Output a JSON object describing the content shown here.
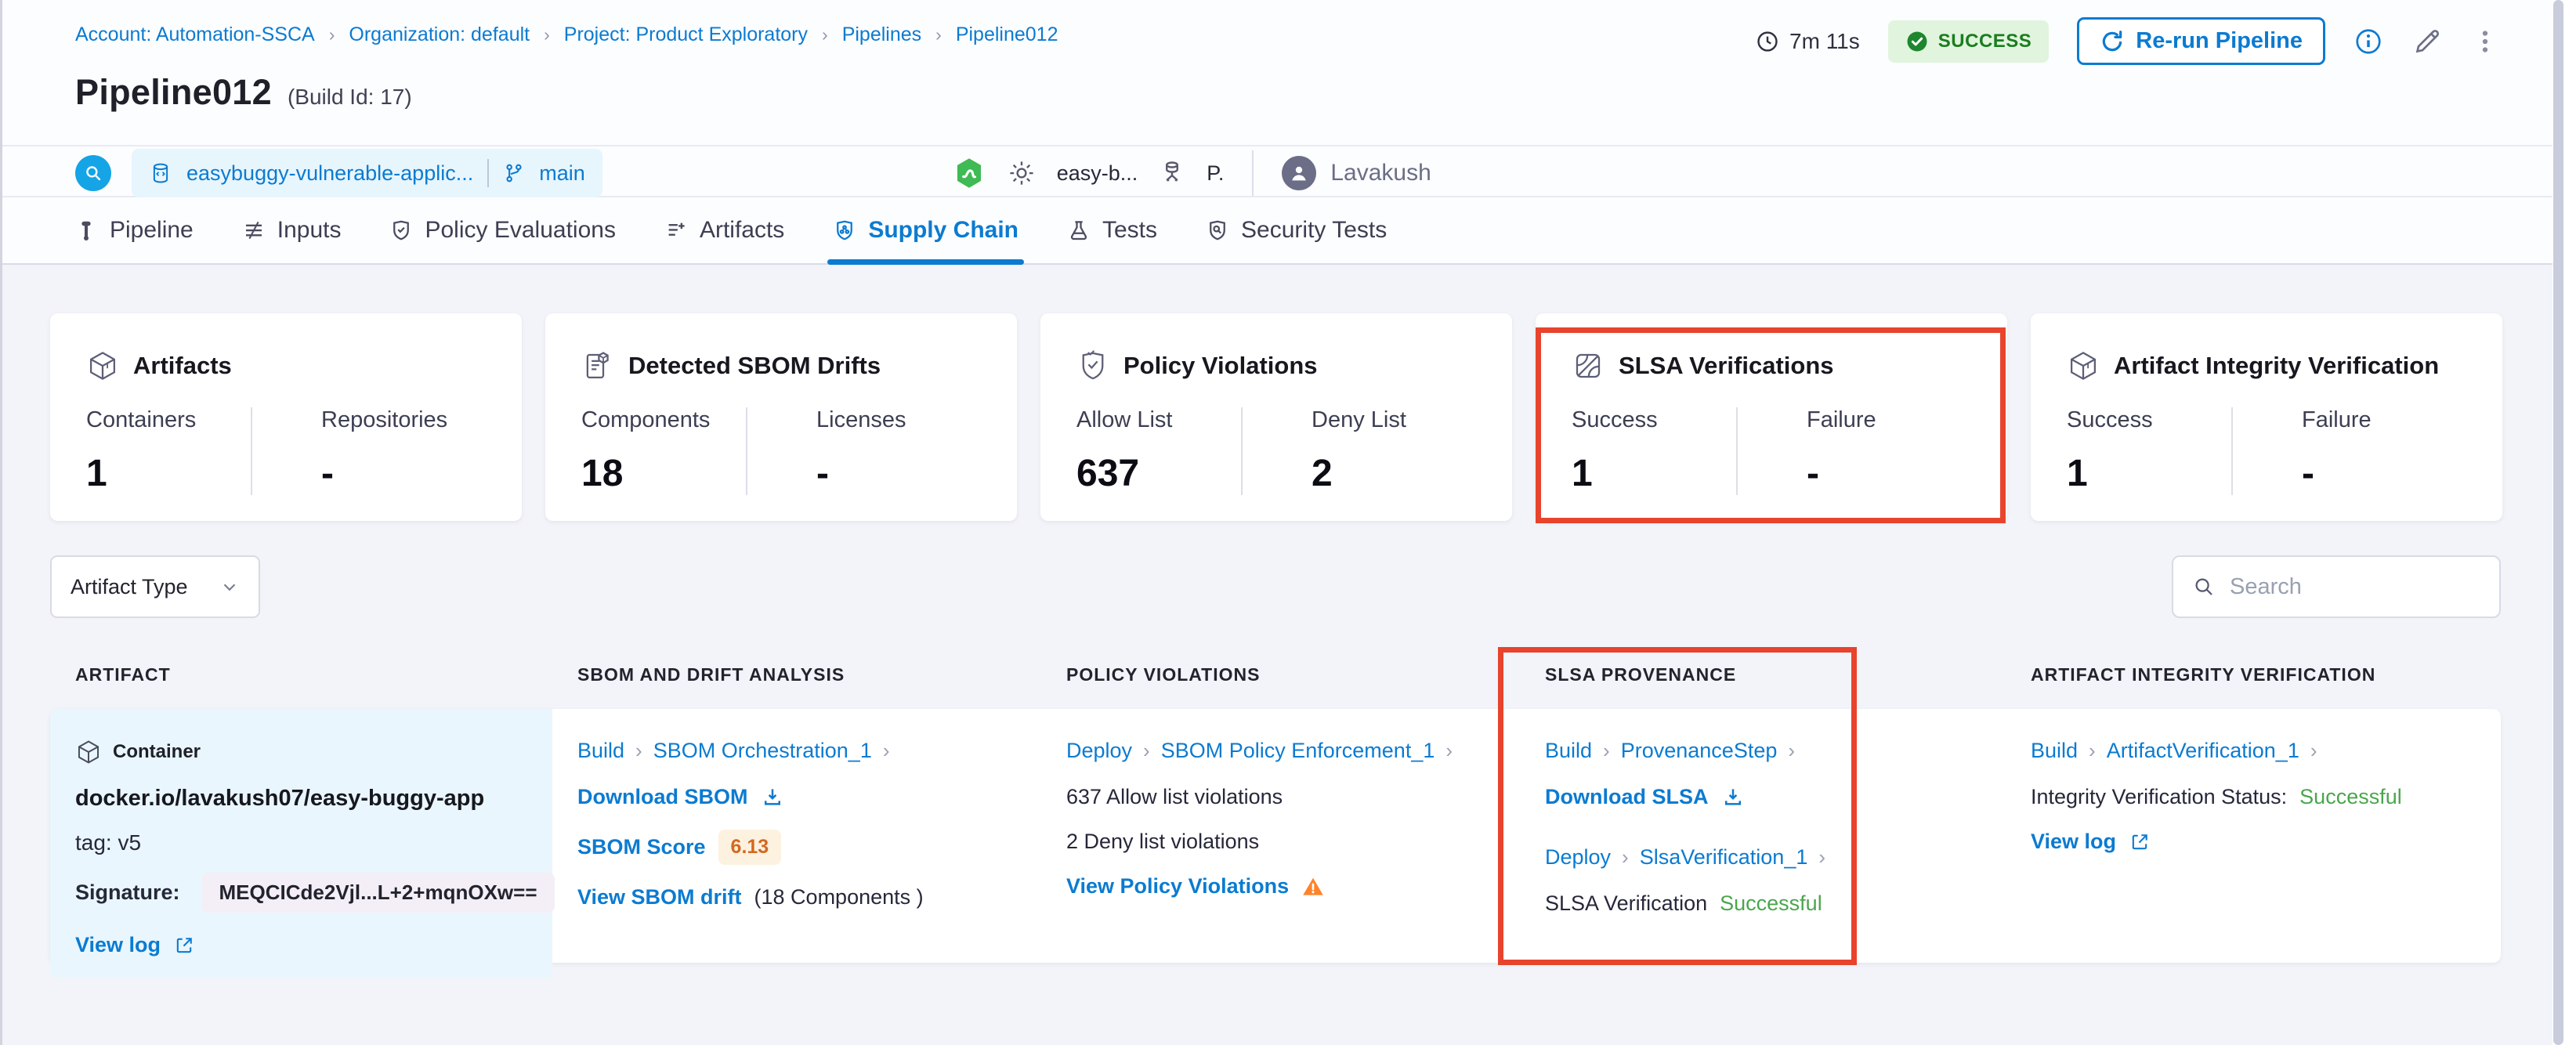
{
  "ui": {
    "chevron": "›",
    "dropdown_caret": "⌄"
  },
  "colors": {
    "accent_blue": "#0b7bd1",
    "success_green_text": "#1a7d1e",
    "status_green": "#4aa64c",
    "highlight_red": "#e8432c",
    "warning_orange": "#ff832b",
    "score_orange": "#d4681e"
  },
  "breadcrumb": {
    "items": [
      "Account: Automation-SSCA",
      "Organization: default",
      "Project: Product Exploratory",
      "Pipelines",
      "Pipeline012"
    ]
  },
  "header": {
    "duration": "7m 11s",
    "status": "SUCCESS",
    "rerun_button": "Re-run Pipeline",
    "title": "Pipeline012",
    "build_id": "(Build Id: 17)"
  },
  "build_info": {
    "repo": "easybuggy-vulnerable-applic...",
    "branch": "main",
    "trigger_pipeline": "easy-b...",
    "trigger_initial": "P.",
    "user": "Lavakush"
  },
  "tabs": [
    {
      "label": "Pipeline"
    },
    {
      "label": "Inputs"
    },
    {
      "label": "Policy Evaluations"
    },
    {
      "label": "Artifacts"
    },
    {
      "label": "Supply Chain"
    },
    {
      "label": "Tests"
    },
    {
      "label": "Security Tests"
    }
  ],
  "summary_cards": [
    {
      "title": "Artifacts",
      "metrics": [
        {
          "label": "Containers",
          "value": "1"
        },
        {
          "label": "Repositories",
          "value": "-"
        }
      ]
    },
    {
      "title": "Detected SBOM Drifts",
      "metrics": [
        {
          "label": "Components",
          "value": "18"
        },
        {
          "label": "Licenses",
          "value": "-"
        }
      ]
    },
    {
      "title": "Policy Violations",
      "metrics": [
        {
          "label": "Allow List",
          "value": "637"
        },
        {
          "label": "Deny List",
          "value": "2"
        }
      ]
    },
    {
      "title": "SLSA Verifications",
      "metrics": [
        {
          "label": "Success",
          "value": "1"
        },
        {
          "label": "Failure",
          "value": "-"
        }
      ]
    },
    {
      "title": "Artifact Integrity Verification",
      "metrics": [
        {
          "label": "Success",
          "value": "1"
        },
        {
          "label": "Failure",
          "value": "-"
        }
      ]
    }
  ],
  "filters": {
    "artifact_type": "Artifact Type",
    "search_placeholder": "Search"
  },
  "table": {
    "headers": [
      "ARTIFACT",
      "SBOM AND DRIFT ANALYSIS",
      "POLICY VIOLATIONS",
      "SLSA PROVENANCE",
      "ARTIFACT INTEGRITY VERIFICATION"
    ],
    "row": {
      "artifact": {
        "type": "Container",
        "image": "docker.io/lavakush07/easy-buggy-app",
        "tag": "tag: v5",
        "signature_label": "Signature:",
        "signature": "MEQCICde2Vjl...L+2+mqnOXw==",
        "view_log": "View log"
      },
      "sbom": {
        "stage": "Build",
        "step": "SBOM Orchestration_1",
        "download": "Download SBOM",
        "score_label": "SBOM Score",
        "score": "6.13",
        "drift_link": "View SBOM drift",
        "drift_info": "(18 Components )"
      },
      "policy": {
        "stage": "Deploy",
        "step": "SBOM Policy Enforcement_1",
        "allow": "637 Allow list violations",
        "deny": "2 Deny list violations",
        "view_link": "View Policy Violations"
      },
      "slsa": {
        "stage1": "Build",
        "step1": "ProvenanceStep",
        "download": "Download SLSA",
        "stage2": "Deploy",
        "step2": "SlsaVerification_1",
        "status_label": "SLSA Verification",
        "status": "Successful"
      },
      "integrity": {
        "stage": "Build",
        "step": "ArtifactVerification_1",
        "status_label": "Integrity Verification Status:",
        "status": "Successful",
        "view_log": "View log"
      }
    }
  }
}
